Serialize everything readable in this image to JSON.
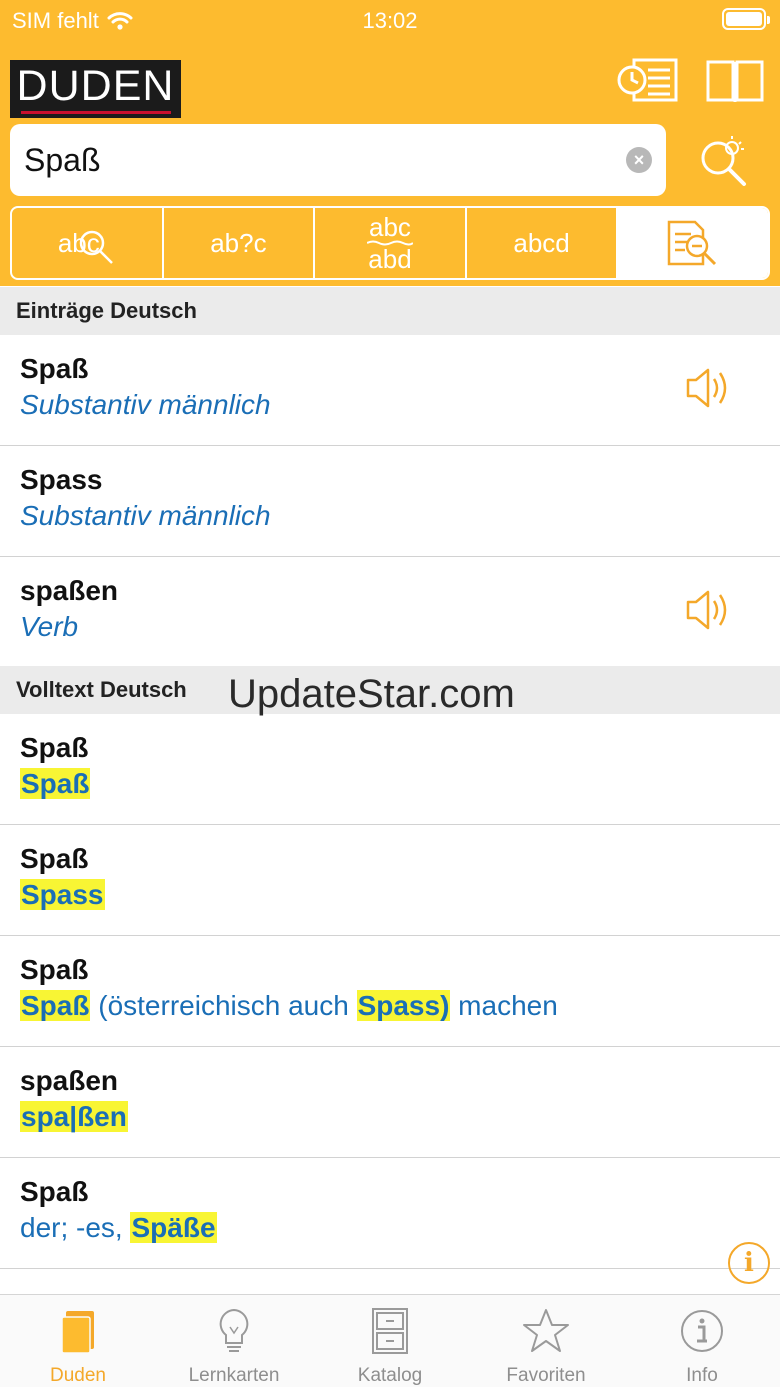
{
  "status_bar": {
    "carrier": "SIM fehlt",
    "time": "13:02"
  },
  "header": {
    "logo_text": "DUDEN",
    "history_icon": "history-list-icon",
    "book_icon": "open-book-icon"
  },
  "search": {
    "value": "Spaß",
    "clear_icon": "clear-icon",
    "button_icon": "magnifier-light-icon"
  },
  "modes": [
    {
      "label": "abc",
      "icon": "spell-search-icon"
    },
    {
      "label": "ab?c",
      "icon": "wildcard-search-icon"
    },
    {
      "label_top": "abc",
      "label_bottom": "abd",
      "icon": "fuzzy-search-icon"
    },
    {
      "label": "abcd",
      "icon": "anagram-search-icon"
    },
    {
      "icon": "fulltext-search-icon"
    }
  ],
  "sections": {
    "entries": "Einträge Deutsch",
    "fulltext": "Volltext Deutsch"
  },
  "entries": [
    {
      "title": "Spaß",
      "subtitle": "Substantiv männlich",
      "has_audio": true
    },
    {
      "title": "Spass",
      "subtitle": "Substantiv männlich",
      "has_audio": false
    },
    {
      "title": "spaßen",
      "subtitle": "Verb",
      "has_audio": true
    }
  ],
  "fulltext": [
    {
      "title": "Spaß",
      "hit": "Spaß"
    },
    {
      "title": "Spaß",
      "hit": "Spass"
    },
    {
      "title": "Spaß",
      "hit1": "Spaß",
      "middle": " (österreichisch auch ",
      "hit2": "Spass)",
      "after": " machen"
    },
    {
      "title": "spaßen",
      "hit": "spa|ßen"
    },
    {
      "title": "Spaß",
      "before": "der; -es, ",
      "hit": "Späße"
    }
  ],
  "watermark": "UpdateStar.com",
  "info_fab": "i",
  "tabs": [
    {
      "label": "Duden",
      "icon": "duden-book-icon",
      "active": true
    },
    {
      "label": "Lernkarten",
      "icon": "lightbulb-icon",
      "active": false
    },
    {
      "label": "Katalog",
      "icon": "cabinet-icon",
      "active": false
    },
    {
      "label": "Favoriten",
      "icon": "star-icon",
      "active": false
    },
    {
      "label": "Info",
      "icon": "info-icon",
      "active": false
    }
  ],
  "colors": {
    "brand": "#fdbb2f",
    "accent": "#f4a82a",
    "link": "#1a6eb6",
    "highlight": "#f8f534"
  }
}
